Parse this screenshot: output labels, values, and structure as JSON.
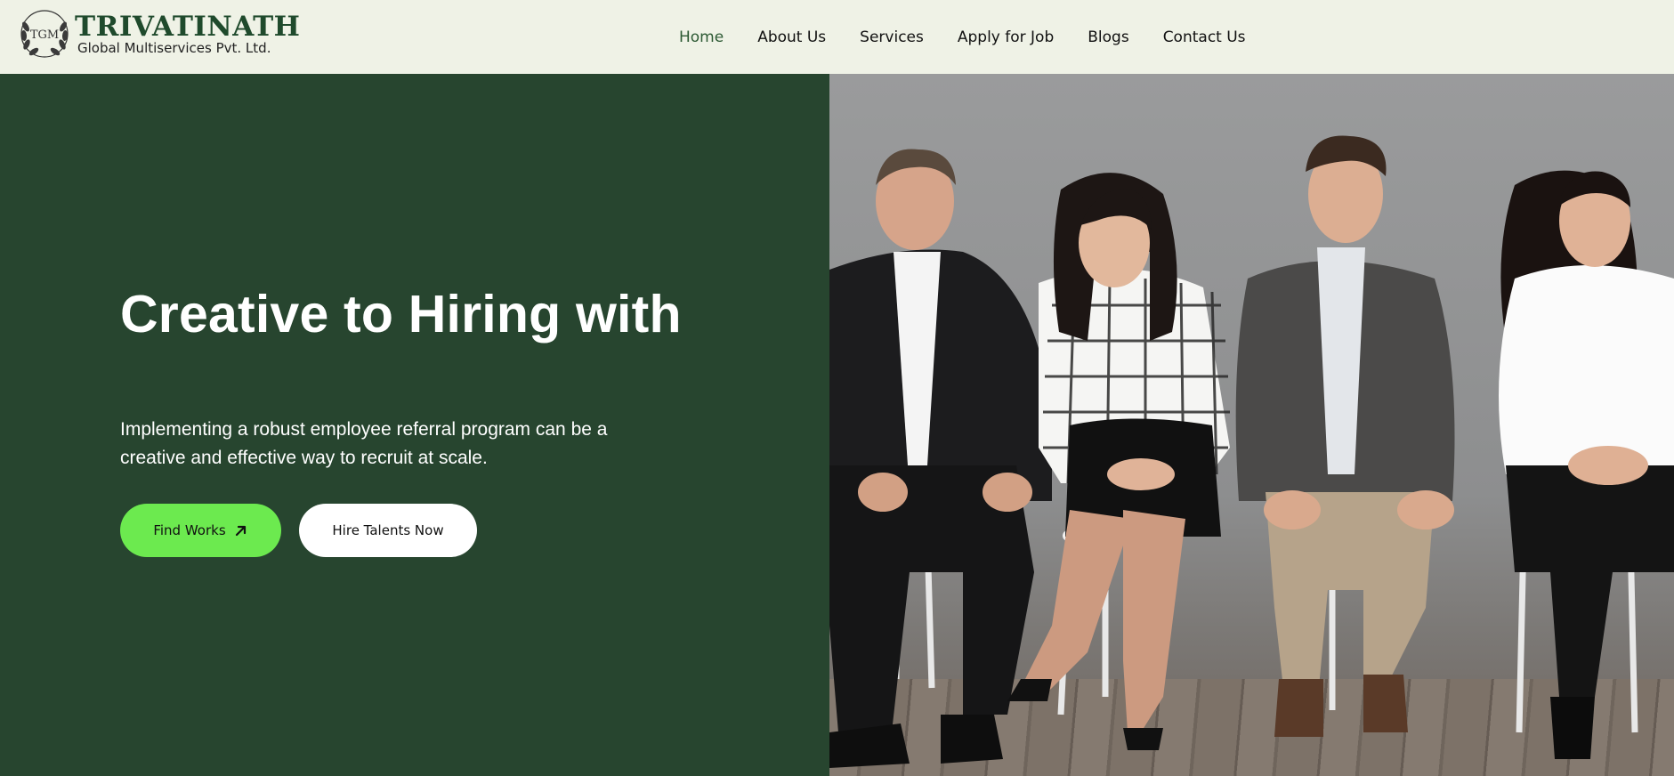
{
  "brand": {
    "emblem_text": "TGM",
    "name": "TRIVATINATH",
    "subtitle": "Global Multiservices Pvt. Ltd."
  },
  "nav": {
    "items": [
      {
        "label": "Home",
        "active": true
      },
      {
        "label": "About Us",
        "active": false
      },
      {
        "label": "Services",
        "active": false
      },
      {
        "label": "Apply for Job",
        "active": false
      },
      {
        "label": "Blogs",
        "active": false
      },
      {
        "label": "Contact Us",
        "active": false
      }
    ]
  },
  "hero": {
    "title": "Creative to Hiring with",
    "description": "Implementing a robust employee referral program can be a creative and effective way to recruit at scale.",
    "primary_button": "Find Works",
    "primary_button_icon": "arrow-up-right-icon",
    "secondary_button": "Hire Talents Now"
  },
  "colors": {
    "brand_green": "#1f4a2c",
    "hero_bg": "#27452f",
    "accent": "#6cea4f",
    "header_bg": "#eff2e6",
    "nav_active": "#2d5a34"
  }
}
